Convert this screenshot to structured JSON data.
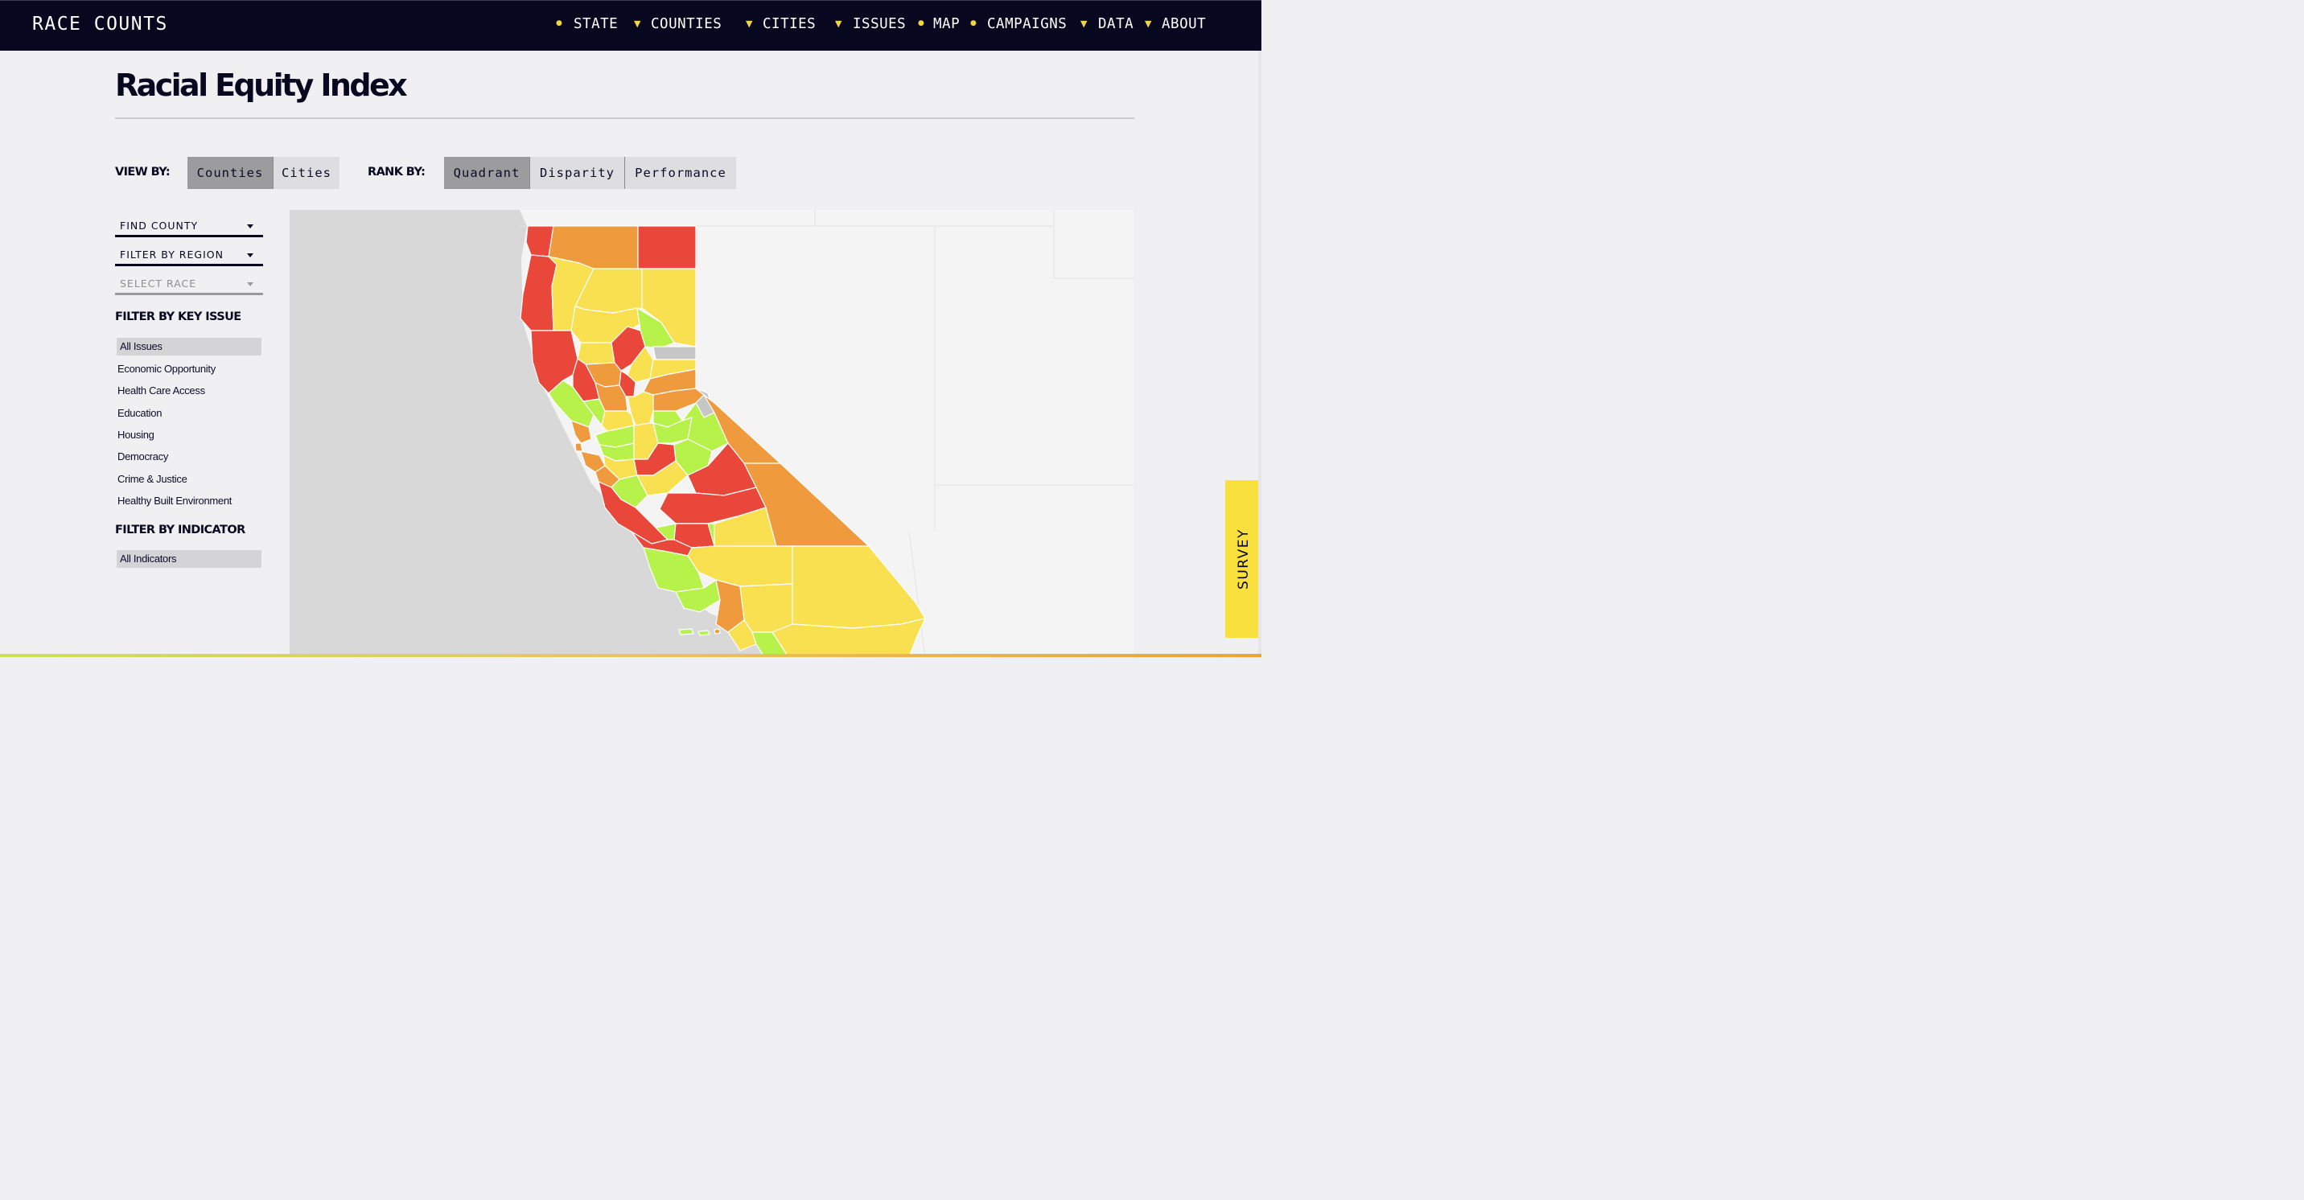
{
  "brand": {
    "logo": "RACE COUNTS"
  },
  "nav": [
    {
      "label": "STATE",
      "mark": "dot"
    },
    {
      "label": "COUNTIES",
      "mark": "caret"
    },
    {
      "label": "CITIES",
      "mark": "caret"
    },
    {
      "label": "ISSUES",
      "mark": "caret"
    },
    {
      "label": "MAP",
      "mark": "dot"
    },
    {
      "label": "CAMPAIGNS",
      "mark": "dot"
    },
    {
      "label": "DATA",
      "mark": "caret"
    },
    {
      "label": "ABOUT",
      "mark": "caret"
    }
  ],
  "page": {
    "title": "Racial Equity Index"
  },
  "controls": {
    "view_by_label": "VIEW BY:",
    "view_by": [
      {
        "label": "Counties",
        "active": true
      },
      {
        "label": "Cities",
        "active": false
      }
    ],
    "rank_by_label": "RANK BY:",
    "rank_by": [
      {
        "label": "Quadrant",
        "active": true
      },
      {
        "label": "Disparity",
        "active": false
      },
      {
        "label": "Performance",
        "active": false
      }
    ]
  },
  "filters": {
    "find_county": "FIND COUNTY",
    "filter_region": "FILTER BY REGION",
    "select_race": "SELECT RACE",
    "key_issue_heading": "FILTER BY KEY ISSUE",
    "key_issues": [
      "All Issues",
      "Economic Opportunity",
      "Health Care Access",
      "Education",
      "Housing",
      "Democracy",
      "Crime & Justice",
      "Healthy Built Environment"
    ],
    "key_issue_selected": "All Issues",
    "indicator_heading": "FILTER BY INDICATOR",
    "indicators": [
      "All Indicators"
    ]
  },
  "survey": {
    "label": "SURVEY"
  },
  "colors": {
    "navy": "#07071f",
    "accent_yellow": "#f2d73b",
    "quadrant_red": "#e8473a",
    "quadrant_orange": "#ee9a3d",
    "quadrant_yellow": "#f8e050",
    "quadrant_green": "#b6f24a",
    "no_data_gray": "#c6c6c6",
    "ocean": "#d8d8d8",
    "land": "#f4f4f4"
  }
}
